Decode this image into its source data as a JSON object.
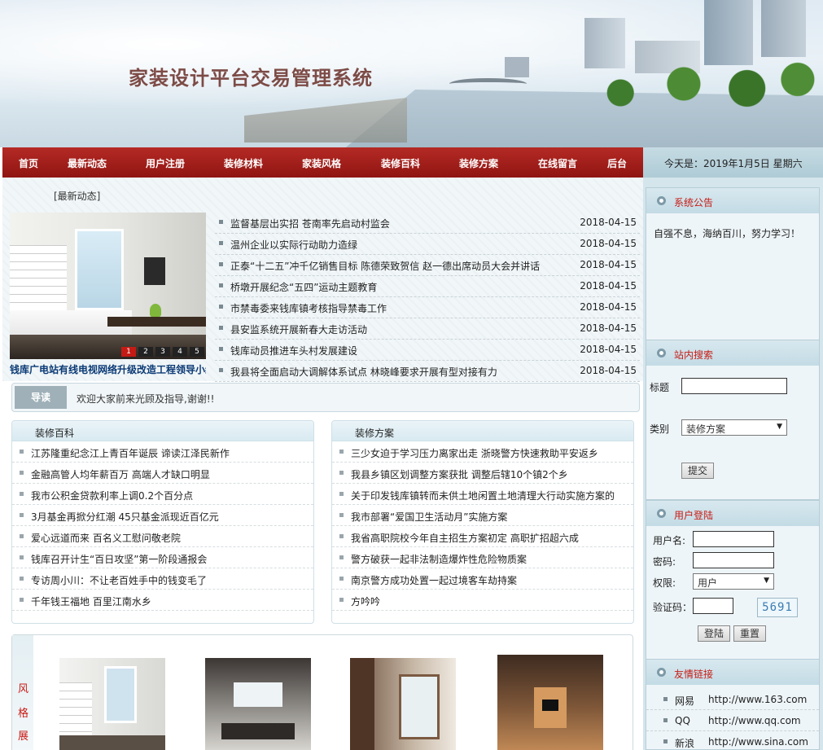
{
  "site": {
    "title": "家装设计平台交易管理系统"
  },
  "nav": [
    "首页",
    "最新动态",
    "用户注册",
    "装修材料",
    "家装风格",
    "装修百科",
    "装修方案",
    "在线留言",
    "后台"
  ],
  "date_text": "今天是：2019年1月5日 星期六",
  "latest": {
    "label": "[最新动态]",
    "slide_caption": "钱库广电站有线电视网络升级改造工程领导小组",
    "slide_dots": [
      "1",
      "2",
      "3",
      "4",
      "5"
    ],
    "items": [
      {
        "title": "监督基层出实招 苍南率先启动村监会",
        "date": "2018-04-15"
      },
      {
        "title": "温州企业以实际行动助力造绿",
        "date": "2018-04-15"
      },
      {
        "title": "正泰“十二五”冲千亿销售目标 陈德荣致贺信 赵一德出席动员大会并讲话",
        "date": "2018-04-15"
      },
      {
        "title": "桥墩开展纪念“五四”运动主题教育",
        "date": "2018-04-15"
      },
      {
        "title": "市禁毒委来钱库镇考核指导禁毒工作",
        "date": "2018-04-15"
      },
      {
        "title": "县安监系统开展新春大走访活动",
        "date": "2018-04-15"
      },
      {
        "title": "钱库动员推进车头村发展建设",
        "date": "2018-04-15"
      },
      {
        "title": "我县将全面启动大调解体系试点 林晓峰要求开展有型对接有力",
        "date": "2018-04-15"
      }
    ]
  },
  "guide": {
    "tag": "导读",
    "message": "欢迎大家前来光顾及指导,谢谢!!"
  },
  "baike": {
    "title": "装修百科",
    "items": [
      "江苏隆重纪念江上青百年诞辰 谛读江泽民新作",
      "金融高管人均年薪百万 高端人才缺口明显",
      "我市公积金贷款利率上调0.2个百分点",
      "3月基金再掀分红潮 45只基金派现近百亿元",
      "爱心远道而来 百名义工慰问敬老院",
      "钱库召开计生“百日攻坚”第一阶段通报会",
      "专访周小川：不让老百姓手中的钱变毛了",
      "千年钱王福地 百里江南水乡"
    ]
  },
  "fangan": {
    "title": "装修方案",
    "items": [
      "三少女迫于学习压力离家出走 浙晓警方快速救助平安返乡",
      "我县乡镇区划调整方案获批 调整后辖10个镇2个乡",
      "关于印发钱库镇转而未供土地闲置土地清理大行动实施方案的",
      "我市部署“爱国卫生活动月”实施方案",
      "我省高职院校今年自主招生方案初定 高职扩招超六成",
      "警方破获一起非法制造爆炸性危险物质案",
      "南京警方成功处置一起过境客车劫持案",
      "方吟吟"
    ]
  },
  "gallery": {
    "side": [
      "风",
      "格",
      "展"
    ]
  },
  "notice": {
    "title": "系统公告",
    "text": "自强不息，海纳百川，努力学习！"
  },
  "search": {
    "title": "站内搜索",
    "label_title": "标题",
    "label_cat": "类别",
    "category": "装修方案",
    "submit": "提交"
  },
  "login": {
    "title": "用户登陆",
    "username": "用户名:",
    "password": "密码:",
    "role": "权限:",
    "role_value": "用户",
    "captcha_label": "验证码：",
    "captcha": "5691",
    "login_btn": "登陆",
    "reset_btn": "重置"
  },
  "links": {
    "title": "友情链接",
    "items": [
      {
        "name": "网易",
        "url": "http://www.163.com"
      },
      {
        "name": "QQ",
        "url": "http://www.qq.com"
      },
      {
        "name": "新浪",
        "url": "http://www.sina.com"
      }
    ]
  },
  "colors": {
    "nav": "#a11f1b",
    "accent_red": "#c81b14",
    "panel": "#d4e5ec"
  }
}
